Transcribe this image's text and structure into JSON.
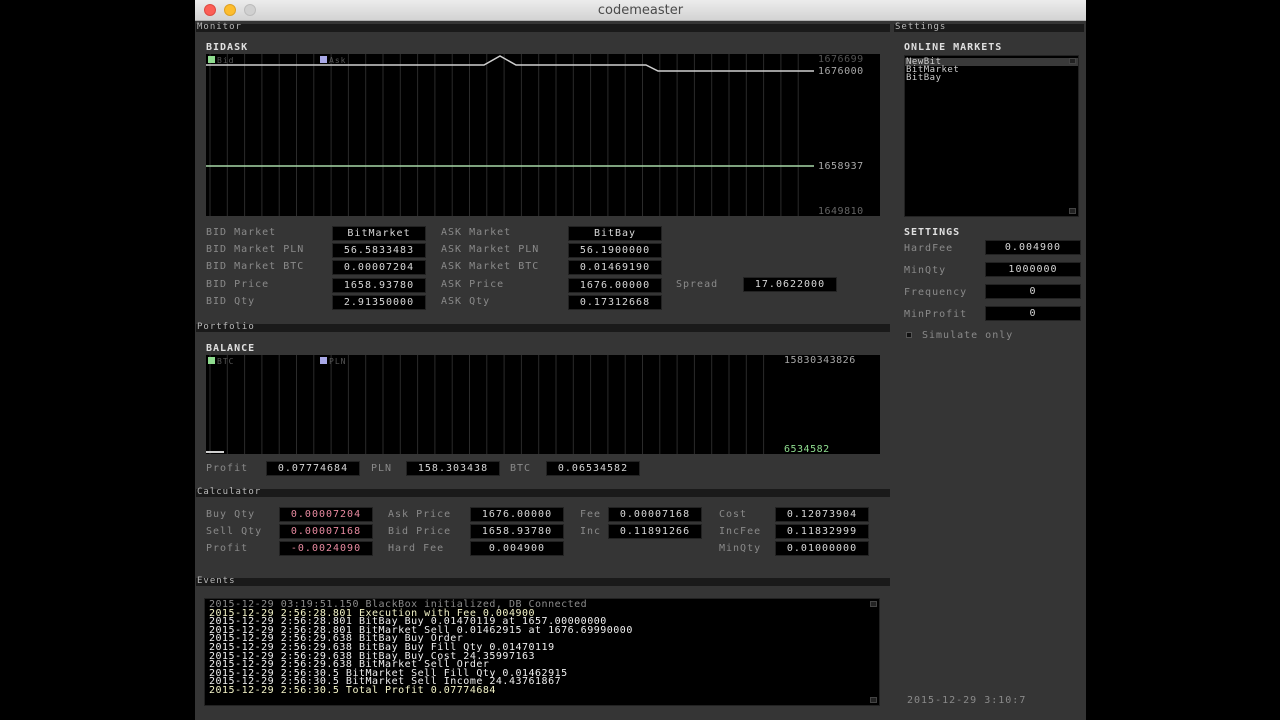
{
  "window": {
    "title": "codemeaster"
  },
  "sections": {
    "monitor": "Monitor",
    "settings": "Settings",
    "portfolio": "Portfolio",
    "calculator": "Calculator",
    "events": "Events"
  },
  "monitor": {
    "bidask_title": "BIDASK",
    "legend": [
      {
        "label": "Bid",
        "color": "#8fdc8f"
      },
      {
        "label": "Ask",
        "color": "#a9a9e8"
      }
    ],
    "y_labels": [
      "1676699",
      "1676000",
      "1658937",
      "1649810"
    ],
    "bid_rows": [
      {
        "label": "BID Market",
        "value": "BitMarket"
      },
      {
        "label": "BID Market PLN",
        "value": "56.5833483"
      },
      {
        "label": "BID Market BTC",
        "value": "0.00007204"
      },
      {
        "label": "BID Price",
        "value": "1658.93780"
      },
      {
        "label": "BID Qty",
        "value": "2.91350000"
      }
    ],
    "ask_rows": [
      {
        "label": "ASK Market",
        "value": "BitBay"
      },
      {
        "label": "ASK Market PLN",
        "value": "56.1900000"
      },
      {
        "label": "ASK Market BTC",
        "value": "0.01469190"
      },
      {
        "label": "ASK Price",
        "value": "1676.00000"
      },
      {
        "label": "ASK Qty",
        "value": "0.17312668"
      }
    ],
    "spread_label": "Spread",
    "spread_value": "17.0622000"
  },
  "portfolio": {
    "balance_title": "BALANCE",
    "legend": [
      {
        "label": "BTC",
        "color": "#8fdc8f"
      },
      {
        "label": "PLN",
        "color": "#a9a9e8"
      }
    ],
    "y_top": "15830343826",
    "y_bottom": "6534582",
    "profit_label": "Profit",
    "profit_value": "0.07774684",
    "pln_label": "PLN",
    "pln_value": "158.303438",
    "btc_label": "BTC",
    "btc_value": "0.06534582"
  },
  "calculator": {
    "col1": [
      {
        "label": "Buy  Qty",
        "value": "0.00007204",
        "neg": true
      },
      {
        "label": "Sell Qty",
        "value": "0.00007168",
        "neg": true
      },
      {
        "label": "Profit",
        "value": "-0.0024090",
        "neg": true
      }
    ],
    "col2": [
      {
        "label": "Ask Price",
        "value": "1676.00000"
      },
      {
        "label": "Bid Price",
        "value": "1658.93780"
      },
      {
        "label": "Hard Fee",
        "value": "0.004900"
      }
    ],
    "col3": [
      {
        "label": "Fee",
        "value": "0.00007168"
      },
      {
        "label": "Inc",
        "value": "0.11891266"
      }
    ],
    "col4": [
      {
        "label": "Cost",
        "value": "0.12073904"
      },
      {
        "label": "IncFee",
        "value": "0.11832999"
      },
      {
        "label": "MinQty",
        "value": "0.01000000"
      }
    ]
  },
  "events": [
    {
      "text": "2015-12-29 03:19:51.150 BlackBox initialized, DB Connected",
      "style": "dim"
    },
    {
      "text": "2015-12-29 2:56:28.801 Execution with Fee 0.004900",
      "style": "hl"
    },
    {
      "text": "2015-12-29 2:56:28.801 BitBay Buy 0.01470119 at 1657.00000000",
      "style": ""
    },
    {
      "text": "2015-12-29 2:56:28.801 BitMarket Sell 0.01462915 at 1676.69990000",
      "style": ""
    },
    {
      "text": "2015-12-29 2:56:29.638 BitBay Buy Order",
      "style": ""
    },
    {
      "text": "2015-12-29 2:56:29.638 BitBay Buy Fill Qty 0.01470119",
      "style": ""
    },
    {
      "text": "2015-12-29 2:56:29.638 BitBay Buy Cost 24.35997163",
      "style": ""
    },
    {
      "text": "2015-12-29 2:56:29.638 BitMarket Sell Order",
      "style": ""
    },
    {
      "text": "2015-12-29 2:56:30.5 BitMarket Sell Fill Qty 0.01462915",
      "style": ""
    },
    {
      "text": "2015-12-29 2:56:30.5 BitMarket Sell Income 24.43761867",
      "style": ""
    },
    {
      "text": "2015-12-29 2:56:30.5 Total Profit 0.07774684",
      "style": "hl"
    }
  ],
  "settings": {
    "online_markets_title": "ONLINE MARKETS",
    "markets": [
      "NewBit",
      "BitMarket",
      "BitBay"
    ],
    "settings_title": "SETTINGS",
    "fields": [
      {
        "label": "HardFee",
        "value": "0.004900"
      },
      {
        "label": "MinQty",
        "value": "1000000"
      },
      {
        "label": "Frequency",
        "value": "0"
      },
      {
        "label": "MinProfit",
        "value": "0"
      }
    ],
    "simulate_label": "Simulate only",
    "clock": "2015-12-29 3:10:7"
  }
}
